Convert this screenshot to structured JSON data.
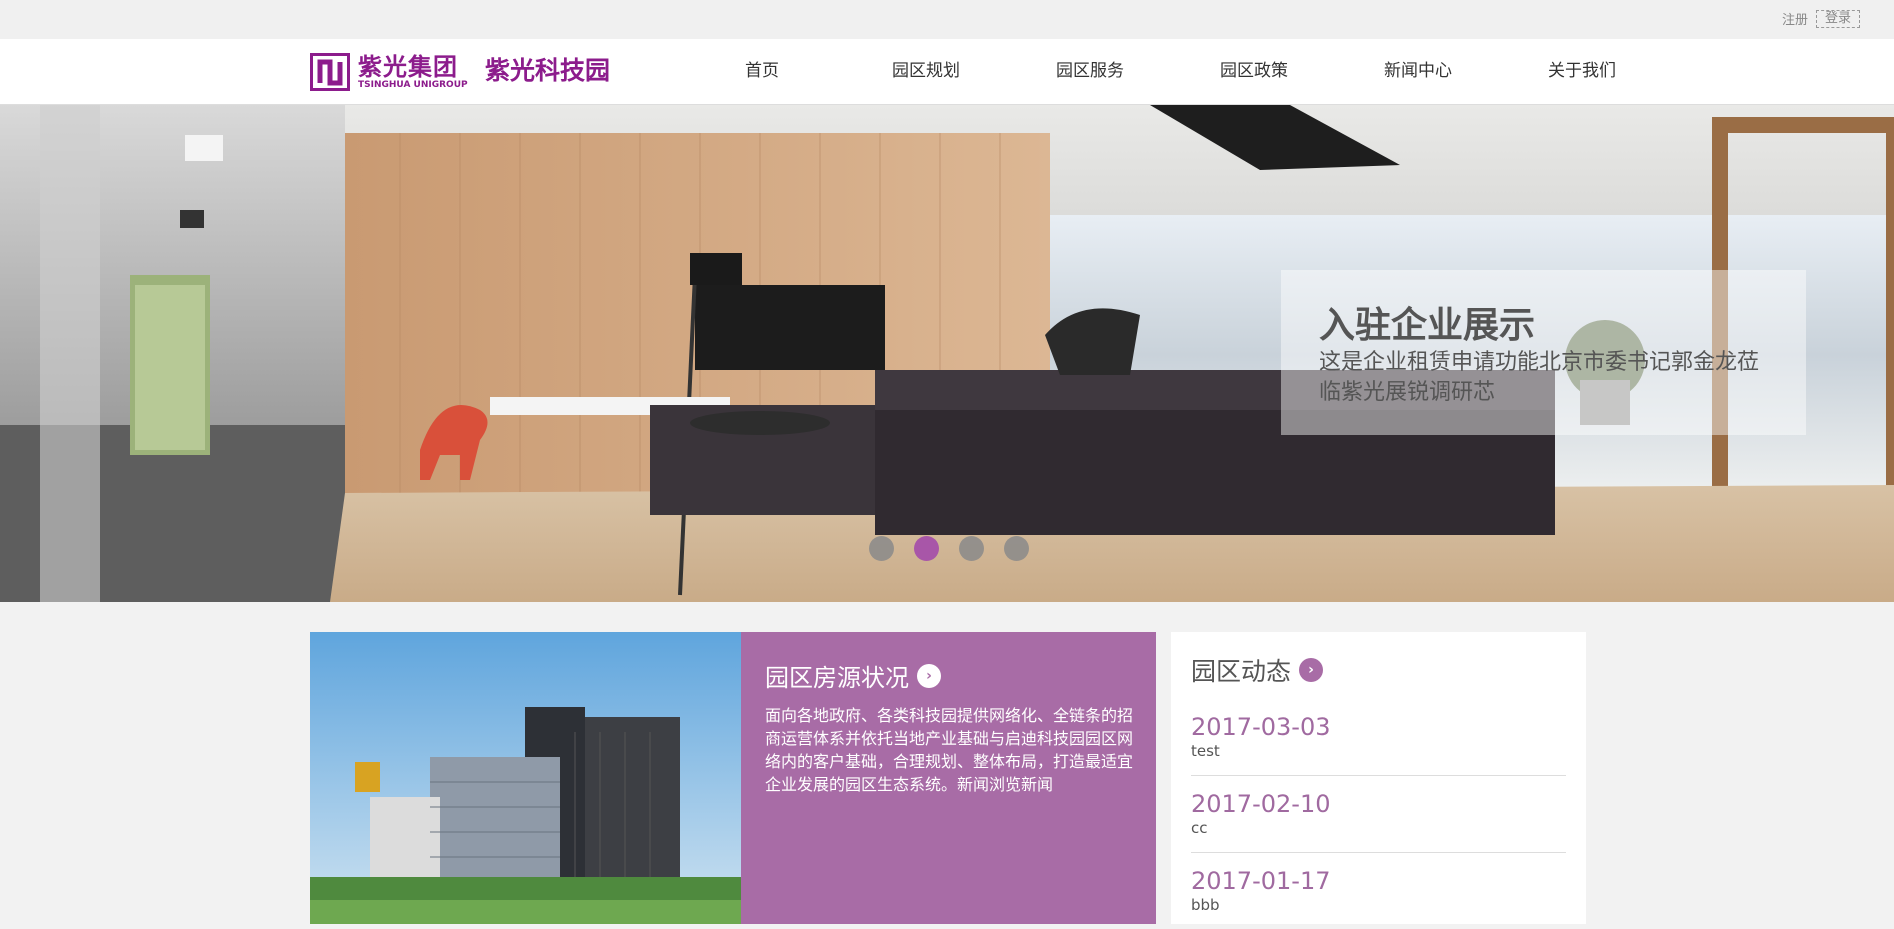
{
  "topbar": {
    "register": "注册",
    "login": "登录"
  },
  "header": {
    "logo_cn": "紫光集团",
    "logo_en": "TSINGHUA UNIGROUP",
    "site_name": "紫光科技园",
    "nav": [
      "首页",
      "园区规划",
      "园区服务",
      "园区政策",
      "新闻中心",
      "关于我们"
    ]
  },
  "banner": {
    "title": "入驻企业展示",
    "description": "这是企业租赁申请功能北京市委书记郭金龙莅临紫光展锐调研芯",
    "slide_count": 4,
    "active_slide": 2
  },
  "housing": {
    "title": "园区房源状况",
    "description": "面向各地政府、各类科技园提供网络化、全链条的招商运营体系并依托当地产业基础与启迪科技园园区网络内的客户基础，合理规划、整体布局，打造最适宜企业发展的园区生态系统。新闻浏览新闻"
  },
  "news": {
    "title": "园区动态",
    "items": [
      {
        "date": "2017-03-03",
        "text": "test"
      },
      {
        "date": "2017-02-10",
        "text": "cc"
      },
      {
        "date": "2017-01-17",
        "text": "bbb"
      }
    ]
  },
  "colors": {
    "brand": "#8c1c8c",
    "accent": "#a86ca6"
  },
  "icons": {
    "section_arrow": "chevron-right-circle-icon"
  }
}
